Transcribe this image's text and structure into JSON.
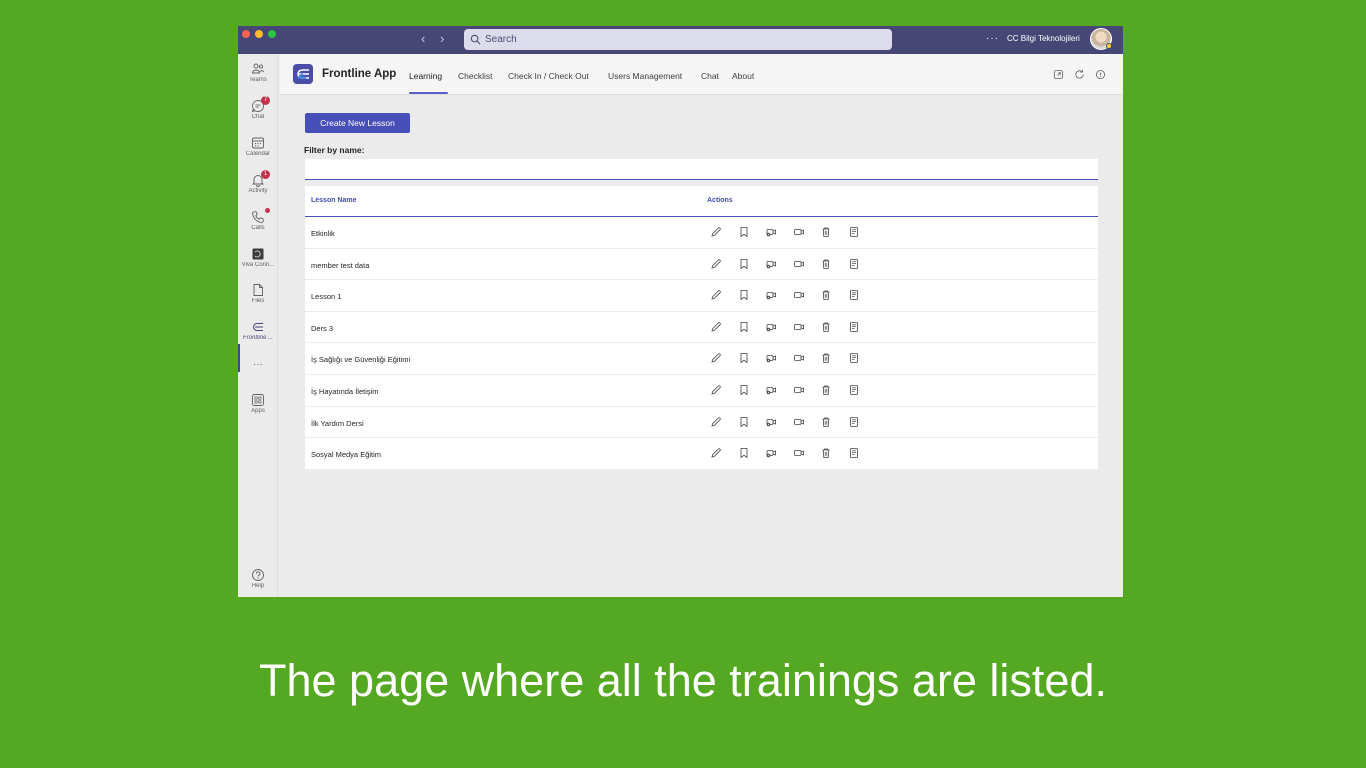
{
  "colors": {
    "background": "#55a821",
    "titlebar": "#464775",
    "accent": "#464eb8",
    "badge": "#c4314b"
  },
  "titlebar": {
    "search_placeholder": "Search",
    "more": "···",
    "org_name": "CC Bilgi Teknolojileri"
  },
  "rail": {
    "items": [
      {
        "label": "Teams",
        "icon": "teams-icon"
      },
      {
        "label": "Chat",
        "icon": "chat-icon",
        "badge": "7"
      },
      {
        "label": "Calendar",
        "icon": "calendar-icon"
      },
      {
        "label": "Activity",
        "icon": "bell-icon",
        "badge": "1"
      },
      {
        "label": "Calls",
        "icon": "phone-icon"
      },
      {
        "label": "Viva Conn...",
        "icon": "viva-connections-icon"
      },
      {
        "label": "Files",
        "icon": "file-icon"
      },
      {
        "label": "Frontline ...",
        "icon": "frontline-app-icon"
      },
      {
        "label": "···",
        "icon": "more-icon"
      },
      {
        "label": "Apps",
        "icon": "apps-icon"
      },
      {
        "label": "Help",
        "icon": "help-icon"
      }
    ]
  },
  "app": {
    "title": "Frontline App",
    "tabs": [
      "Learning",
      "Checklist",
      "Check In / Check Out",
      "Users Management",
      "Chat",
      "About"
    ],
    "active_tab": "Learning"
  },
  "main": {
    "create_button": "Create New Lesson",
    "filter_label": "Filter by name:",
    "filter_value": "",
    "columns": [
      "Lesson Name",
      "Actions"
    ],
    "action_icons": [
      "edit-icon",
      "bookmark-icon",
      "video-assign-icon",
      "video-icon",
      "delete-icon",
      "report-icon"
    ],
    "rows": [
      "Etkinlik",
      "member test data",
      "Lesson 1",
      "Ders 3",
      "İş Sağlığı ve Güvenliği Eğitimi",
      "İş Hayatında İletişim",
      "İlk Yardım Dersi",
      "Sosyal Medya Eğitim"
    ]
  },
  "caption": "The page where all the trainings are listed."
}
